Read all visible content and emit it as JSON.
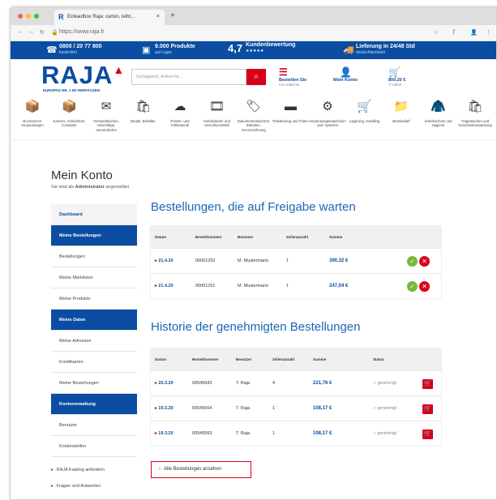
{
  "browser": {
    "tab_title": "Einkaufbox Raja: carton, leiht...",
    "tab_logo": "R",
    "tab_close": "×",
    "new_tab": "+",
    "url": "https://www.raja.fr"
  },
  "topbar": {
    "phone": {
      "value": "0800 / 20 77 800",
      "sub": "kostenfrei",
      "icon": "phone-icon"
    },
    "products": {
      "value": "9.000 Produkte",
      "sub": "auf Lager",
      "icon": "truck-icon"
    },
    "rating": {
      "value": "4,7",
      "label": "Kundenbewertung",
      "stars": "★★★★★"
    },
    "delivery": {
      "value": "Lieferung in 24/48 Std",
      "sub": "deutschlandweit",
      "icon": "delivery-truck-icon"
    }
  },
  "header": {
    "logo_text": "RAJA",
    "logo_accent": "▲",
    "tagline": "EUROPAS NR. 1 IM VERPACKEN",
    "search_placeholder": "Schlagwort, Artikel-Nr...",
    "search_icon": "⌕",
    "order_button": {
      "label": "Bestellen Sie",
      "sub": "mit Artikel-Nr"
    },
    "account_button": {
      "label": "Mein Konto"
    },
    "cart_button": {
      "label": "800,20 €",
      "sub": "7 Artikel"
    }
  },
  "categories": [
    {
      "label": "Ecommerce Verpackungen",
      "icon": "📦"
    },
    {
      "label": "Kartons, Schachteln, Container",
      "icon": "📦"
    },
    {
      "label": "Versandtaschen, Umschläge, Versandrohre",
      "icon": "✉"
    },
    {
      "label": "Beutel, Behälter",
      "icon": "🛍"
    },
    {
      "label": "Polster- und Füllmaterial",
      "icon": "☁"
    },
    {
      "label": "Klebebänder und Verschlussmittel",
      "icon": "🎞"
    },
    {
      "label": "Dokumententaschen, Etiketten, Kennzeichnung",
      "icon": "🏷"
    },
    {
      "label": "Palettierung und Folien",
      "icon": "▬"
    },
    {
      "label": "Verpackungsmaschinen und -systeme",
      "icon": "⚙"
    },
    {
      "label": "Lagerung, Handling",
      "icon": "🛒"
    },
    {
      "label": "Bürobedarf",
      "icon": "📁"
    },
    {
      "label": "Arbeitsschutz und Hygiene",
      "icon": "🧥"
    },
    {
      "label": "Tragetaschen und Geschenkverpackung",
      "icon": "🛍"
    }
  ],
  "page": {
    "title": "Mein Konto",
    "subtitle_prefix": "Sie sind als ",
    "subtitle_role": "Administrator",
    "subtitle_suffix": " angemeldet"
  },
  "sidebar": {
    "items": [
      {
        "label": "Dashboard",
        "type": "active"
      },
      {
        "label": "Meine Bestellungen",
        "type": "head"
      },
      {
        "label": "Bestellungen",
        "type": "item"
      },
      {
        "label": "Meine Merklisten",
        "type": "item"
      },
      {
        "label": "Meine Produkte",
        "type": "item"
      },
      {
        "label": "Meine Daten",
        "type": "head"
      },
      {
        "label": "Meine Adressen",
        "type": "item"
      },
      {
        "label": "Kreditkarten",
        "type": "item"
      },
      {
        "label": "Meine Bewertungen",
        "type": "item"
      },
      {
        "label": "Kontoverwaltung",
        "type": "head"
      },
      {
        "label": "Benutzer",
        "type": "item"
      },
      {
        "label": "Kostenstellen",
        "type": "item"
      }
    ],
    "links": [
      {
        "label": "RAJA Katalog anfordern",
        "arrow": "▸"
      },
      {
        "label": "Fragen und Antworten",
        "arrow": "▸"
      }
    ]
  },
  "pending": {
    "title": "Bestellungen, die auf Freigabe warten",
    "columns": [
      "Datum",
      "Bestellnummer",
      "Benutzer",
      "Zeilenanzahl",
      "Summe"
    ],
    "rows": [
      {
        "date": "21.4.20",
        "number": "00001252",
        "user": "M. Mustermann",
        "lines": "1",
        "sum": "390,32 €"
      },
      {
        "date": "21.4.20",
        "number": "00001251",
        "user": "M. Mustermann",
        "lines": "1",
        "sum": "247,04 €"
      }
    ],
    "approve_icon": "✓",
    "reject_icon": "✕"
  },
  "history": {
    "title": "Historie der genehmigten Bestellungen",
    "columns": [
      "Datum",
      "Bestellnummer",
      "Benutzer",
      "Zeilenanzahl",
      "Summe",
      "Status"
    ],
    "rows": [
      {
        "date": "20.3.20",
        "number": "00545683",
        "user": "T. Raja",
        "lines": "4",
        "sum": "221,76 €",
        "status": "✓ genehmigt"
      },
      {
        "date": "19.3.20",
        "number": "00545664",
        "user": "T. Raja",
        "lines": "1",
        "sum": "108,17 €",
        "status": "✓ genehmigt"
      },
      {
        "date": "19.3.20",
        "number": "00545563",
        "user": "T. Raja",
        "lines": "1",
        "sum": "108,17 €",
        "status": "✓ genehmigt"
      }
    ],
    "reorder_icon": "🛒",
    "all_orders_button": "Alle Bestellungen ansehen",
    "all_orders_arrow": "›"
  },
  "colors": {
    "brand_blue": "#0a4da2",
    "brand_red": "#d9001b",
    "approve_green": "#78b83a"
  }
}
